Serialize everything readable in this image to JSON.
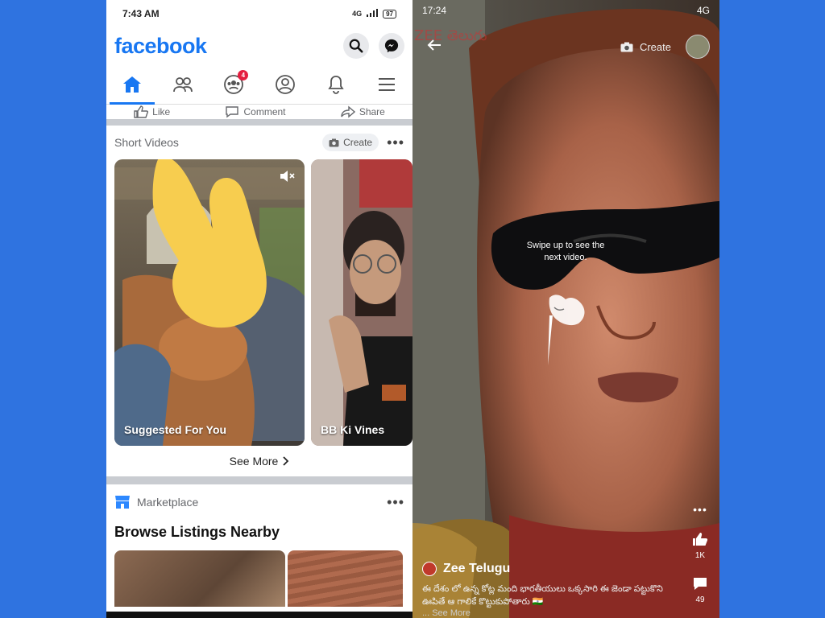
{
  "left_phone": {
    "status": {
      "time": "7:43 AM",
      "network": "4G",
      "battery": "97"
    },
    "header": {
      "logo": "facebook",
      "search_icon": "search-icon",
      "messenger_icon": "messenger-icon"
    },
    "nav": {
      "groups_badge": "4"
    },
    "actions": {
      "like": "Like",
      "comment": "Comment",
      "share": "Share"
    },
    "short_videos": {
      "title": "Short Videos",
      "create_label": "Create",
      "more_icon": "•••",
      "cards": [
        {
          "label": "Suggested For You"
        },
        {
          "label": "BB Ki Vines"
        }
      ],
      "see_more": "See More"
    },
    "marketplace": {
      "title": "Marketplace",
      "more_icon": "•••",
      "heading": "Browse Listings Nearby"
    }
  },
  "right_phone": {
    "status": {
      "time": "17:24",
      "network": "4G"
    },
    "create_label": "Create",
    "overlay": "Swipe up to see the next video.",
    "likes": "1K",
    "comments": "49",
    "more_icon": "•••",
    "channel": "Zee Telugu",
    "caption": "ఈ దేశం లో ఉన్న కోట్ల మంది భారతీయులు ఒక్కసారి ఈ జెండా పట్టుకొని ఊపితే ఆ గాలికే కొట్టుకుపోతారు 🇮🇳",
    "see_more": "... See More"
  },
  "colors": {
    "background": "#2f73e0",
    "fb_blue": "#1877f2",
    "badge": "#e41e3f"
  }
}
